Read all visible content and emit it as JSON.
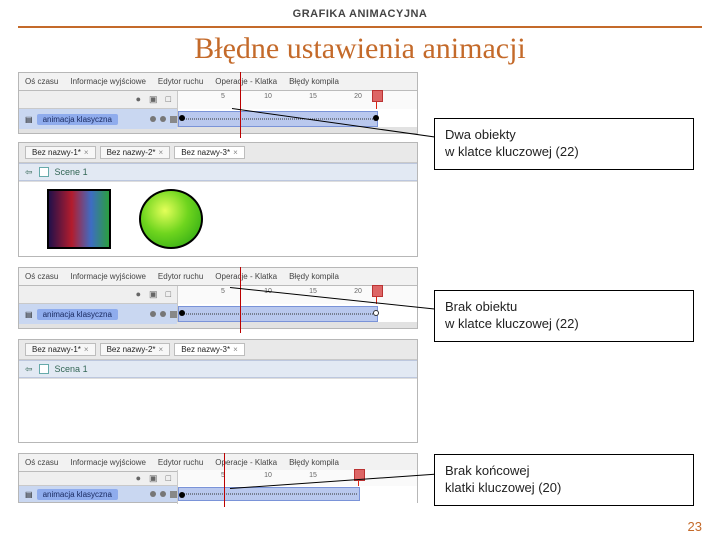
{
  "supertitle": "GRAFIKA ANIMACYJNA",
  "title": "Błędne ustawienia animacji",
  "page_number": "23",
  "tabs": {
    "t1": "Oś czasu",
    "t2": "Informacje wyjściowe",
    "t3": "Edytor ruchu",
    "t4": "Operacje - Klatka",
    "t5": "Błędy kompila"
  },
  "ruler": {
    "n5": "5",
    "n10": "10",
    "n15": "15",
    "n20": "20"
  },
  "layer": {
    "name": "animacja klasyczna"
  },
  "callouts": {
    "c1_line1": "Dwa obiekty",
    "c1_line2": "w klatce kluczowej (22)",
    "c2_line1": "Brak obiektu",
    "c2_line2": "w klatce kluczowej (22)",
    "c3_line1": "Brak końcowej",
    "c3_line2": "klatki kluczowej (20)"
  },
  "bottom_tabs": {
    "b1": "Bez nazwy-1*",
    "b2": "Bez nazwy-2*",
    "b3": "Bez nazwy-3*"
  },
  "scene_labels": {
    "scene1": "Scene 1",
    "scena1": "Scena 1"
  }
}
